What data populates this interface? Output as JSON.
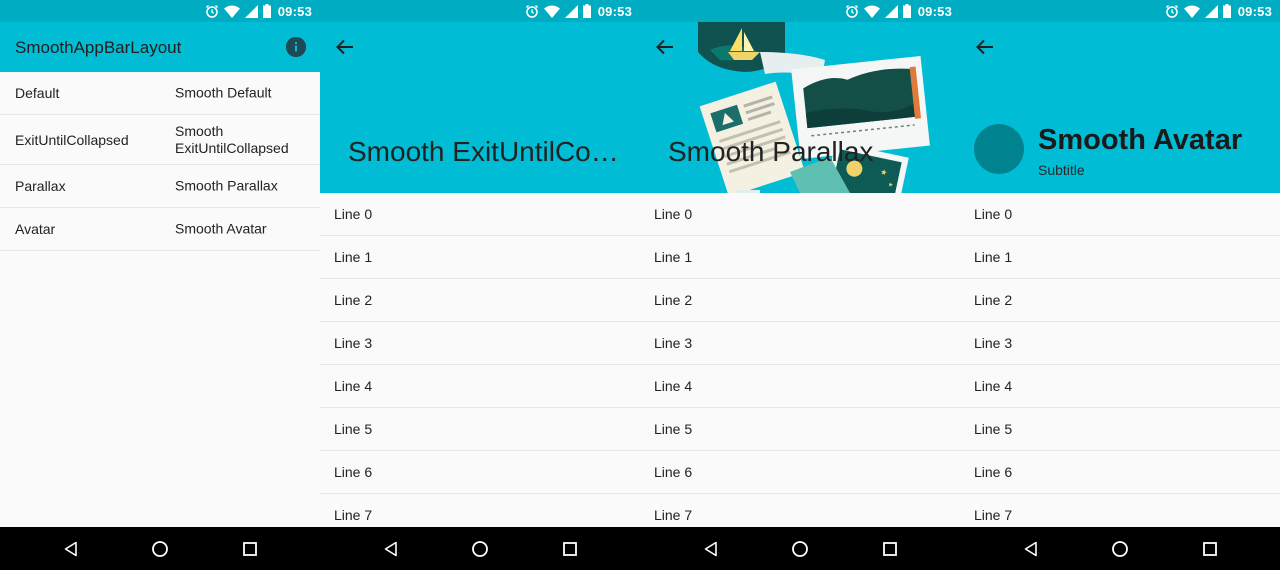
{
  "status_bar": {
    "time": "09:53"
  },
  "main_screen": {
    "title": "SmoothAppBarLayout",
    "info_icon": "info-icon",
    "items": [
      {
        "key": "Default",
        "value": "Smooth Default"
      },
      {
        "key": "ExitUntilCollapsed",
        "value": "Smooth\nExitUntilCollapsed"
      },
      {
        "key": "Parallax",
        "value": "Smooth Parallax"
      },
      {
        "key": "Avatar",
        "value": "Smooth Avatar"
      }
    ]
  },
  "exit_screen": {
    "title": "Smooth ExitUntilCollapsed"
  },
  "parallax_screen": {
    "title": "Smooth Parallax"
  },
  "avatar_screen": {
    "title": "Smooth Avatar",
    "subtitle": "Subtitle"
  },
  "list_lines": [
    "Line 0",
    "Line 1",
    "Line 2",
    "Line 3",
    "Line 4",
    "Line 5",
    "Line 6",
    "Line 7"
  ],
  "colors": {
    "status_bar": "#00acc1",
    "app_bar": "#00bcd4",
    "avatar": "#00838f",
    "list_bg": "#fafafa",
    "nav_bar": "#000000"
  },
  "icons": {
    "status": [
      "alarm-icon",
      "wifi-icon",
      "signal-icon",
      "battery-icon"
    ],
    "nav": [
      "back-triangle-icon",
      "home-circle-icon",
      "recents-square-icon"
    ],
    "toolbar_back": "arrow-left-icon"
  }
}
